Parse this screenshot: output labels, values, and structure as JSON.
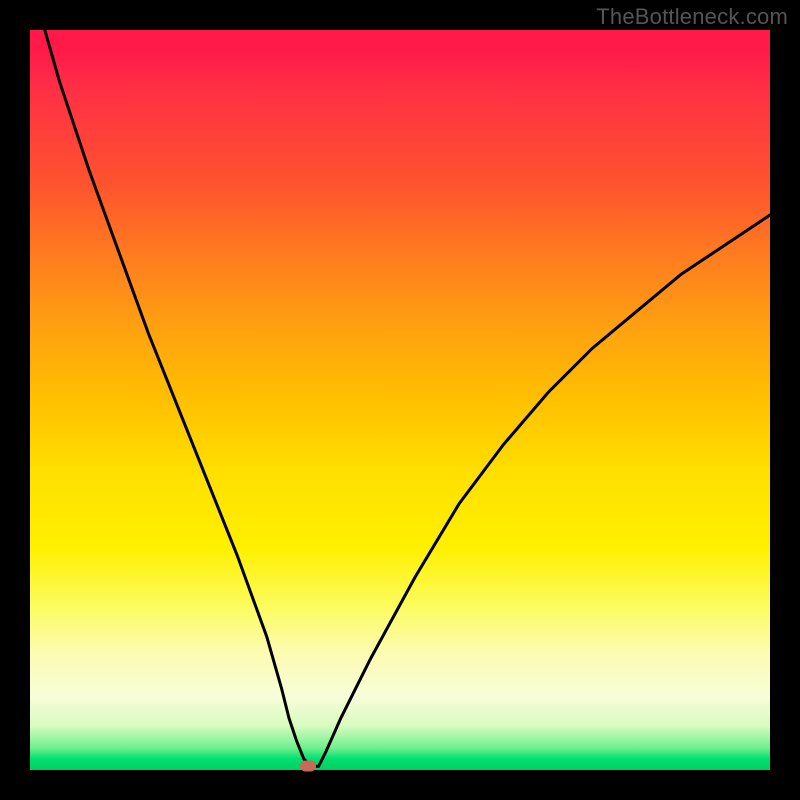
{
  "watermark": "TheBottleneck.com",
  "chart_data": {
    "type": "line",
    "title": "",
    "xlabel": "",
    "ylabel": "",
    "xlim": [
      0,
      100
    ],
    "ylim": [
      0,
      100
    ],
    "grid": false,
    "legend": false,
    "series": [
      {
        "name": "curve",
        "x": [
          2,
          4,
          8,
          12,
          16,
          20,
          24,
          28,
          32,
          34,
          35,
          36,
          37,
          38,
          39,
          40,
          42,
          46,
          52,
          58,
          64,
          70,
          76,
          82,
          88,
          94,
          100
        ],
        "values": [
          100,
          93,
          81,
          70,
          59,
          49,
          39,
          29,
          18,
          11,
          7,
          4,
          1.5,
          0.5,
          0.5,
          2.5,
          7,
          15,
          26,
          36,
          44,
          51,
          57,
          62,
          67,
          71,
          75
        ]
      }
    ],
    "marker": {
      "x": 37.5,
      "y": 0.5
    },
    "gradient_stops": [
      {
        "pct": 0,
        "color": "#ff1a4a"
      },
      {
        "pct": 50,
        "color": "#ffc000"
      },
      {
        "pct": 80,
        "color": "#fcfc80"
      },
      {
        "pct": 100,
        "color": "#00d060"
      }
    ]
  }
}
